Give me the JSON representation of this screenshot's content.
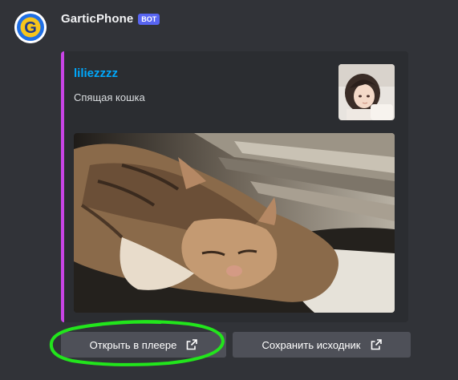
{
  "message": {
    "username": "GarticPhone",
    "badge": "BOT",
    "avatar_icon": "gartic-g-logo-icon"
  },
  "embed": {
    "accent_color": "#c944e6",
    "author": "liliezzzz",
    "description": "Спящая кошка",
    "thumbnail": "anime-girl-thumbnail",
    "image": "sleeping-cat-drawing"
  },
  "buttons": [
    {
      "label": "Открыть в плеере",
      "icon": "external-link-icon"
    },
    {
      "label": "Сохранить исходник",
      "icon": "external-link-icon"
    }
  ],
  "annotation": {
    "color": "#22e51c",
    "shape": "hand-drawn ellipse around first button"
  }
}
